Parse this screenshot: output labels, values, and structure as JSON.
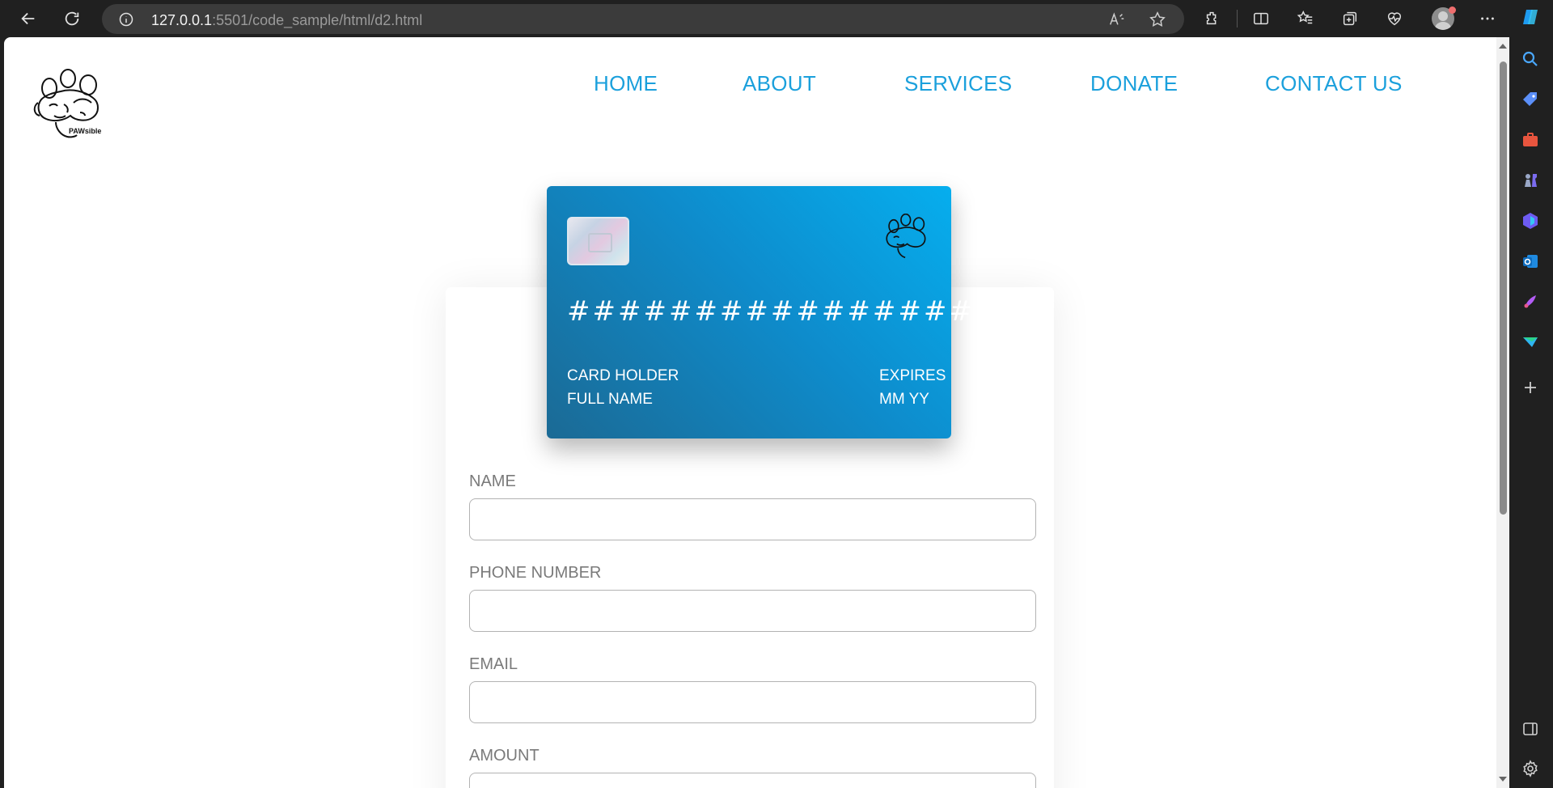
{
  "browser": {
    "url_host": "127.0.0.1",
    "url_path": ":5501/code_sample/html/d2.html"
  },
  "site": {
    "logo_text": "PAWsible",
    "nav": [
      {
        "label": "HOME"
      },
      {
        "label": "ABOUT"
      },
      {
        "label": "SERVICES"
      },
      {
        "label": "DONATE"
      },
      {
        "label": "CONTACT US"
      }
    ]
  },
  "card": {
    "number": "################",
    "holder_label": "CARD HOLDER",
    "holder_value": "FULL NAME",
    "expires_label": "EXPIRES",
    "expires_value": "MM YY"
  },
  "form": {
    "fields": [
      {
        "label": "NAME",
        "value": ""
      },
      {
        "label": "PHONE NUMBER",
        "value": ""
      },
      {
        "label": "EMAIL",
        "value": ""
      },
      {
        "label": "AMOUNT",
        "value": ""
      }
    ]
  },
  "colors": {
    "nav_link": "#1ba0dc",
    "card_gradient_start": "#06aeee",
    "card_gradient_end": "#1b6a95"
  }
}
